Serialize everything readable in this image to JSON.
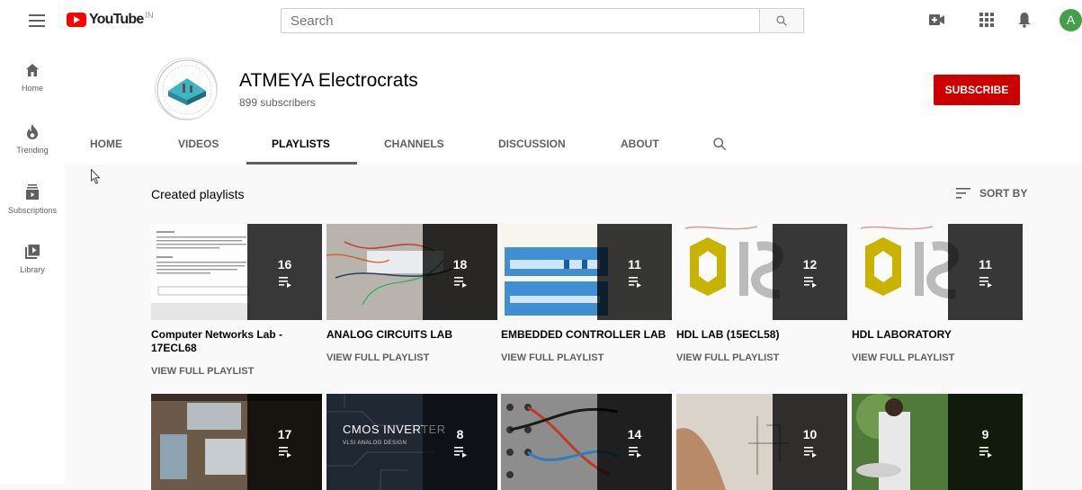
{
  "topbar": {
    "logo_text": "YouTube",
    "logo_country": "IN",
    "search_placeholder": "Search",
    "avatar_letter": "A"
  },
  "sidebar": {
    "items": [
      {
        "label": "Home",
        "icon": "home-icon"
      },
      {
        "label": "Trending",
        "icon": "trending-icon"
      },
      {
        "label": "Subscriptions",
        "icon": "subscriptions-icon"
      },
      {
        "label": "Library",
        "icon": "library-icon"
      }
    ]
  },
  "channel": {
    "name": "ATMEYA Electrocrats",
    "subscribers": "899 subscribers",
    "subscribe_label": "SUBSCRIBE"
  },
  "tabs": [
    "HOME",
    "VIDEOS",
    "PLAYLISTS",
    "CHANNELS",
    "DISCUSSION",
    "ABOUT"
  ],
  "active_tab": "PLAYLISTS",
  "content": {
    "section_title": "Created playlists",
    "sort_label": "SORT BY",
    "view_full_label": "VIEW FULL PLAYLIST"
  },
  "playlists_row1": [
    {
      "title": "Computer Networks Lab - 17ECL68",
      "count": "16",
      "thumb": "document"
    },
    {
      "title": "ANALOG CIRCUITS LAB",
      "count": "18",
      "thumb": "breadboard"
    },
    {
      "title": "EMBEDDED CONTROLLER LAB",
      "count": "11",
      "thumb": "algorithm"
    },
    {
      "title": "HDL LAB (15ECL58)",
      "count": "12",
      "thumb": "ise"
    },
    {
      "title": "HDL LABORATORY",
      "count": "11",
      "thumb": "ise"
    }
  ],
  "playlists_row2": [
    {
      "count": "17",
      "thumb": "lab-device"
    },
    {
      "count": "8",
      "thumb": "cmos",
      "thumb_text": "CMOS INVERTER",
      "thumb_subtext": "VLSI ANALOG DESIGN"
    },
    {
      "count": "14",
      "thumb": "wires"
    },
    {
      "count": "10",
      "thumb": "paper"
    },
    {
      "count": "9",
      "thumb": "outdoor"
    }
  ],
  "colors": {
    "subscribe": "#cc0000",
    "background": "#f9f9f9",
    "avatar": "#43a047"
  }
}
